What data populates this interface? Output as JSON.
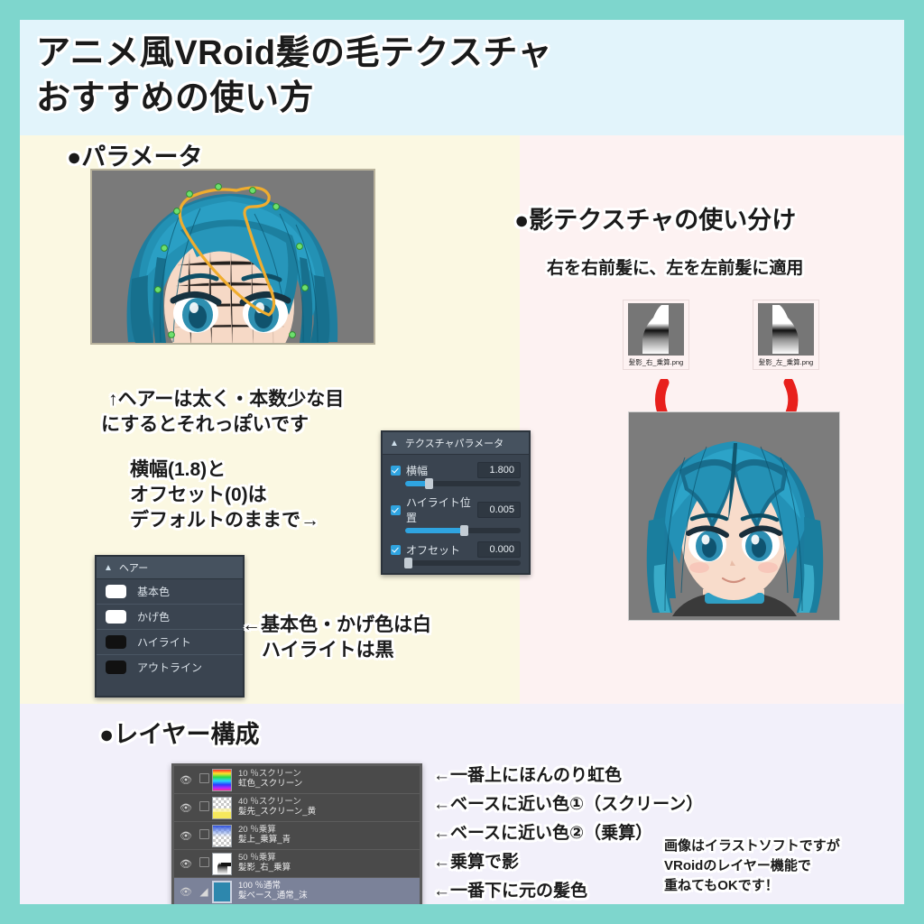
{
  "theme": {
    "border_teal": "#7ed6cd",
    "title_band": "#e2f4fb",
    "cream_panel": "#fbf8e2",
    "pink_panel": "#fdf2f2",
    "lavender_panel": "#f2f0fa",
    "accent_blue": "#2fa4e0",
    "guide_orange": "#f0ad2e",
    "arrow_red": "#e8201c"
  },
  "title": {
    "line1": "アニメ風VRoid髪の毛テクスチャ",
    "line2": "おすすめの使い方"
  },
  "sections": {
    "parameters_heading": "●パラメータ",
    "shadow_texture_heading": "●影テクスチャの使い分け",
    "shadow_texture_sub": "右を右前髪に、左を左前髪に適用",
    "layer_structure_heading": "●レイヤー構成"
  },
  "left_notes": {
    "hair_tip_line1": "↑ヘアーは太く・本数少な目",
    "hair_tip_line2": "にするとそれっぽいです",
    "default_note_line1": "横幅(1.8)と",
    "default_note_line2": "オフセット(0)は",
    "default_note_line3": "デフォルトのままで→",
    "color_note_line1": "←基本色・かげ色は白",
    "color_note_line2": "ハイライトは黒"
  },
  "texture_panel": {
    "header": "テクスチャパラメータ",
    "rows": [
      {
        "label": "横幅",
        "value": "1.800",
        "checked": true,
        "fill_pct": 20,
        "knob_pct": 20
      },
      {
        "label": "ハイライト位置",
        "value": "0.005",
        "checked": true,
        "fill_pct": 51,
        "knob_pct": 51
      },
      {
        "label": "オフセット",
        "value": "0.000",
        "checked": true,
        "fill_pct": 0,
        "knob_pct": 2
      }
    ]
  },
  "hair_panel": {
    "header": "ヘアー",
    "rows": [
      {
        "label": "基本色",
        "swatch": "white"
      },
      {
        "label": "かげ色",
        "swatch": "white"
      },
      {
        "label": "ハイライト",
        "swatch": "black"
      },
      {
        "label": "アウトライン",
        "swatch": "black"
      }
    ]
  },
  "shadow_textures": [
    {
      "filename": "髪影_右_乗算.png",
      "side": "right"
    },
    {
      "filename": "髪影_左_乗算.png",
      "side": "left"
    }
  ],
  "layer_panel": {
    "layers": [
      {
        "mode": "10 ％スクリーン",
        "name": "虹色_スクリーン",
        "thumb": "rainbow",
        "visible": true,
        "selected": false
      },
      {
        "mode": "40 ％スクリーン",
        "name": "髪先_スクリーン_黄",
        "thumb": "checker-yellow",
        "visible": true,
        "selected": false
      },
      {
        "mode": "20 ％乗算",
        "name": "髪上_乗算_青",
        "thumb": "checker-blue",
        "visible": true,
        "selected": false
      },
      {
        "mode": "50 ％乗算",
        "name": "髪影_右_乗算",
        "thumb": "shadow-gradient",
        "visible": true,
        "selected": false
      },
      {
        "mode": "100 ％通常",
        "name": "髪ベース_通常_沫",
        "thumb": "solid-blue",
        "visible": true,
        "selected": true
      }
    ]
  },
  "layer_annotations": [
    "←一番上にほんのり虹色",
    "←ベースに近い色①（スクリーン）",
    "←ベースに近い色②（乗算）",
    "←乗算で影",
    "←一番下に元の髪色"
  ],
  "footer_note": {
    "line1": "画像はイラストソフトですが",
    "line2": "VRoidのレイヤー機能で",
    "line3": "重ねてもOKです！"
  }
}
